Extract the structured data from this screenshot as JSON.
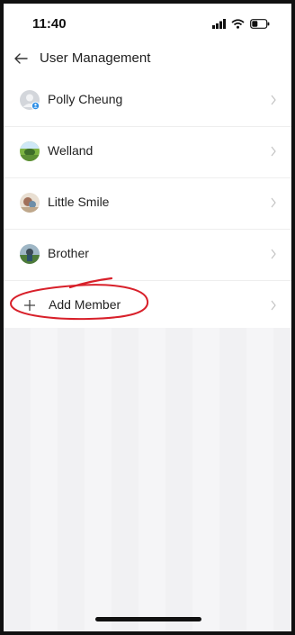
{
  "status_bar": {
    "time": "11:40"
  },
  "nav": {
    "title": "User Management",
    "back_icon": "arrow-left-icon"
  },
  "members": [
    {
      "name": "Polly Cheung",
      "avatar_icon": "default-avatar-icon"
    },
    {
      "name": "Welland",
      "avatar_icon": "photo-avatar-icon"
    },
    {
      "name": "Little Smile",
      "avatar_icon": "photo-avatar-icon"
    },
    {
      "name": "Brother",
      "avatar_icon": "photo-avatar-icon"
    }
  ],
  "add_member": {
    "label": "Add Member",
    "icon": "plus-icon"
  },
  "colors": {
    "annotation": "#d8202a",
    "badge": "#2f8fe6"
  }
}
